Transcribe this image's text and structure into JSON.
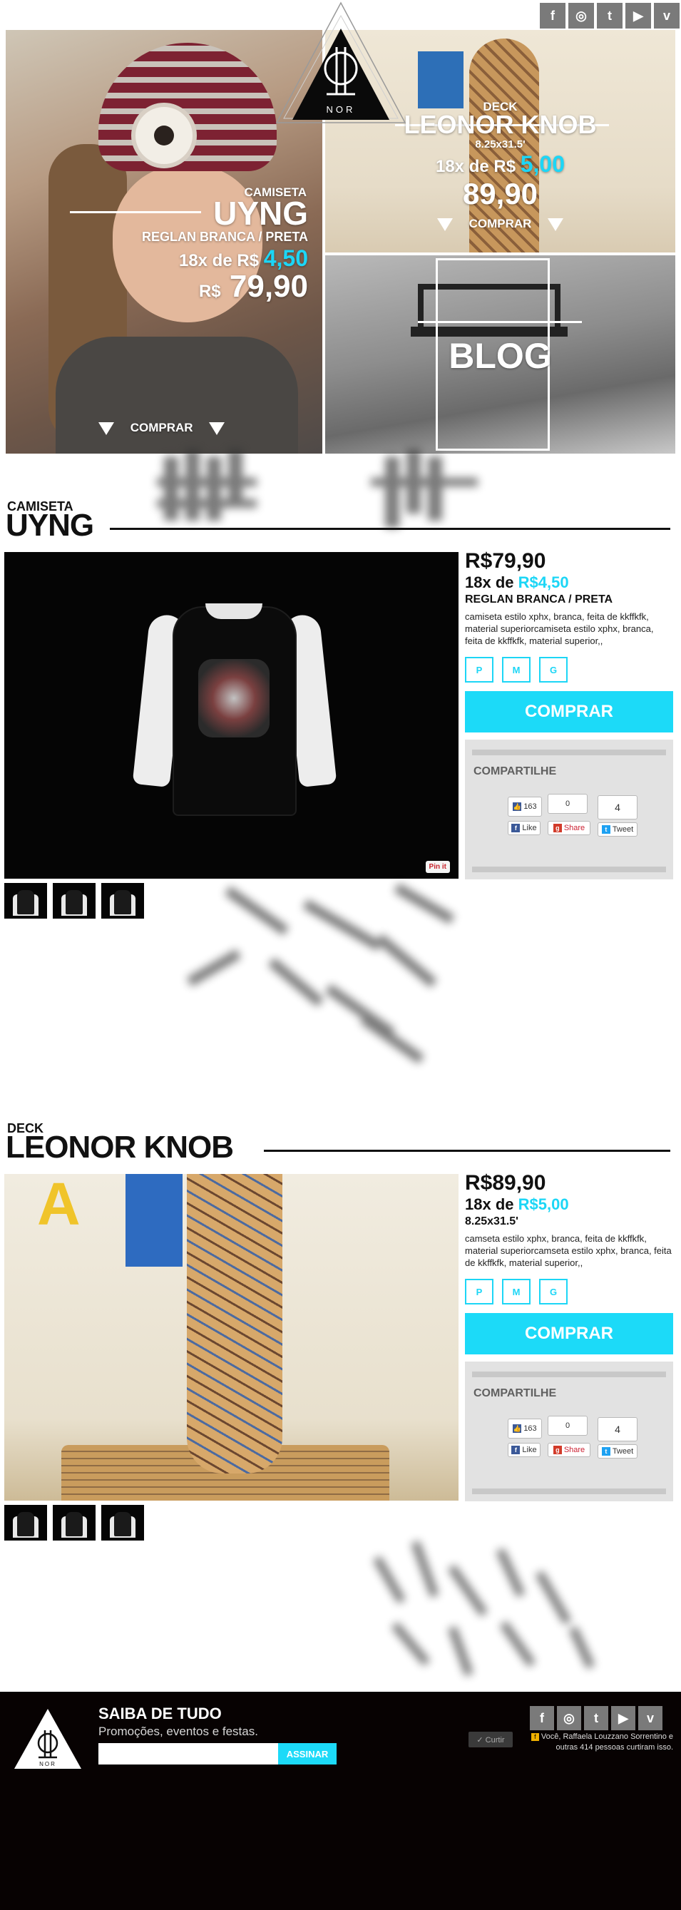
{
  "brand": {
    "logo_text": "NOR"
  },
  "social": {
    "icons": [
      {
        "name": "facebook-icon",
        "glyph": "f"
      },
      {
        "name": "instagram-icon",
        "glyph": "◎"
      },
      {
        "name": "twitter-icon",
        "glyph": "t"
      },
      {
        "name": "youtube-icon",
        "glyph": "▶"
      },
      {
        "name": "vimeo-icon",
        "glyph": "v"
      }
    ]
  },
  "hero": {
    "shirt": {
      "type": "CAMISETA",
      "name": "UYNG",
      "variant": "REGLAN BRANCA / PRETA",
      "install_prefix": "18x de R$",
      "install_value": "4,50",
      "currency": "R$",
      "price": "79,90",
      "cta": "COMPRAR"
    },
    "deck": {
      "type": "DECK",
      "name": "LEONOR KNOB",
      "size": "8.25x31.5'",
      "install_prefix": "18x de R$",
      "install_value": "5,00",
      "price": "89,90",
      "cta": "COMPRAR"
    },
    "blog": {
      "label": "BLOG"
    }
  },
  "products": [
    {
      "type": "CAMISETA",
      "name": "UYNG",
      "price": "R$79,90",
      "install_prefix": "18x de",
      "install_value": "R$4,50",
      "sub": "REGLAN BRANCA / PRETA",
      "desc": "camiseta estilo xphx, branca, feita de kkffkfk, material superiorcamiseta estilo xphx, branca, feita de kkffkfk, material superior,,",
      "sizes": [
        "P",
        "M",
        "G"
      ],
      "buy": "COMPRAR",
      "share_title": "COMPARTILHE",
      "like_count": "163",
      "share_count": "0",
      "tweet_count": "4",
      "like_label": "Like",
      "share_label": "Share",
      "tweet_label": "Tweet",
      "pinit": "Pin it"
    },
    {
      "type": "DECK",
      "name": "LEONOR KNOB",
      "price": "R$89,90",
      "install_prefix": "18x de",
      "install_value": "R$5,00",
      "sub": "8.25x31.5'",
      "desc": "camseta estilo xphx, branca, feita de kkffkfk, material superiorcamseta estilo xphx, branca, feita de kkffkfk, material superior,,",
      "sizes": [
        "P",
        "M",
        "G"
      ],
      "buy": "COMPRAR",
      "share_title": "COMPARTILHE",
      "like_count": "163",
      "share_count": "0",
      "tweet_count": "4",
      "like_label": "Like",
      "share_label": "Share",
      "tweet_label": "Tweet"
    }
  ],
  "footer": {
    "title": "SAIBA DE TUDO",
    "subtitle": "Promoções, eventos e festas.",
    "email_placeholder": "",
    "subscribe": "ASSINAR",
    "fb_like": "✓ Curtir",
    "fb_text": "Você, Raffaela Louzzano Sorrentino e outras 414 pessoas curtiram isso.",
    "logo_text": "NOR"
  },
  "colors": {
    "accent": "#1cdaf8",
    "dark": "#070202"
  }
}
